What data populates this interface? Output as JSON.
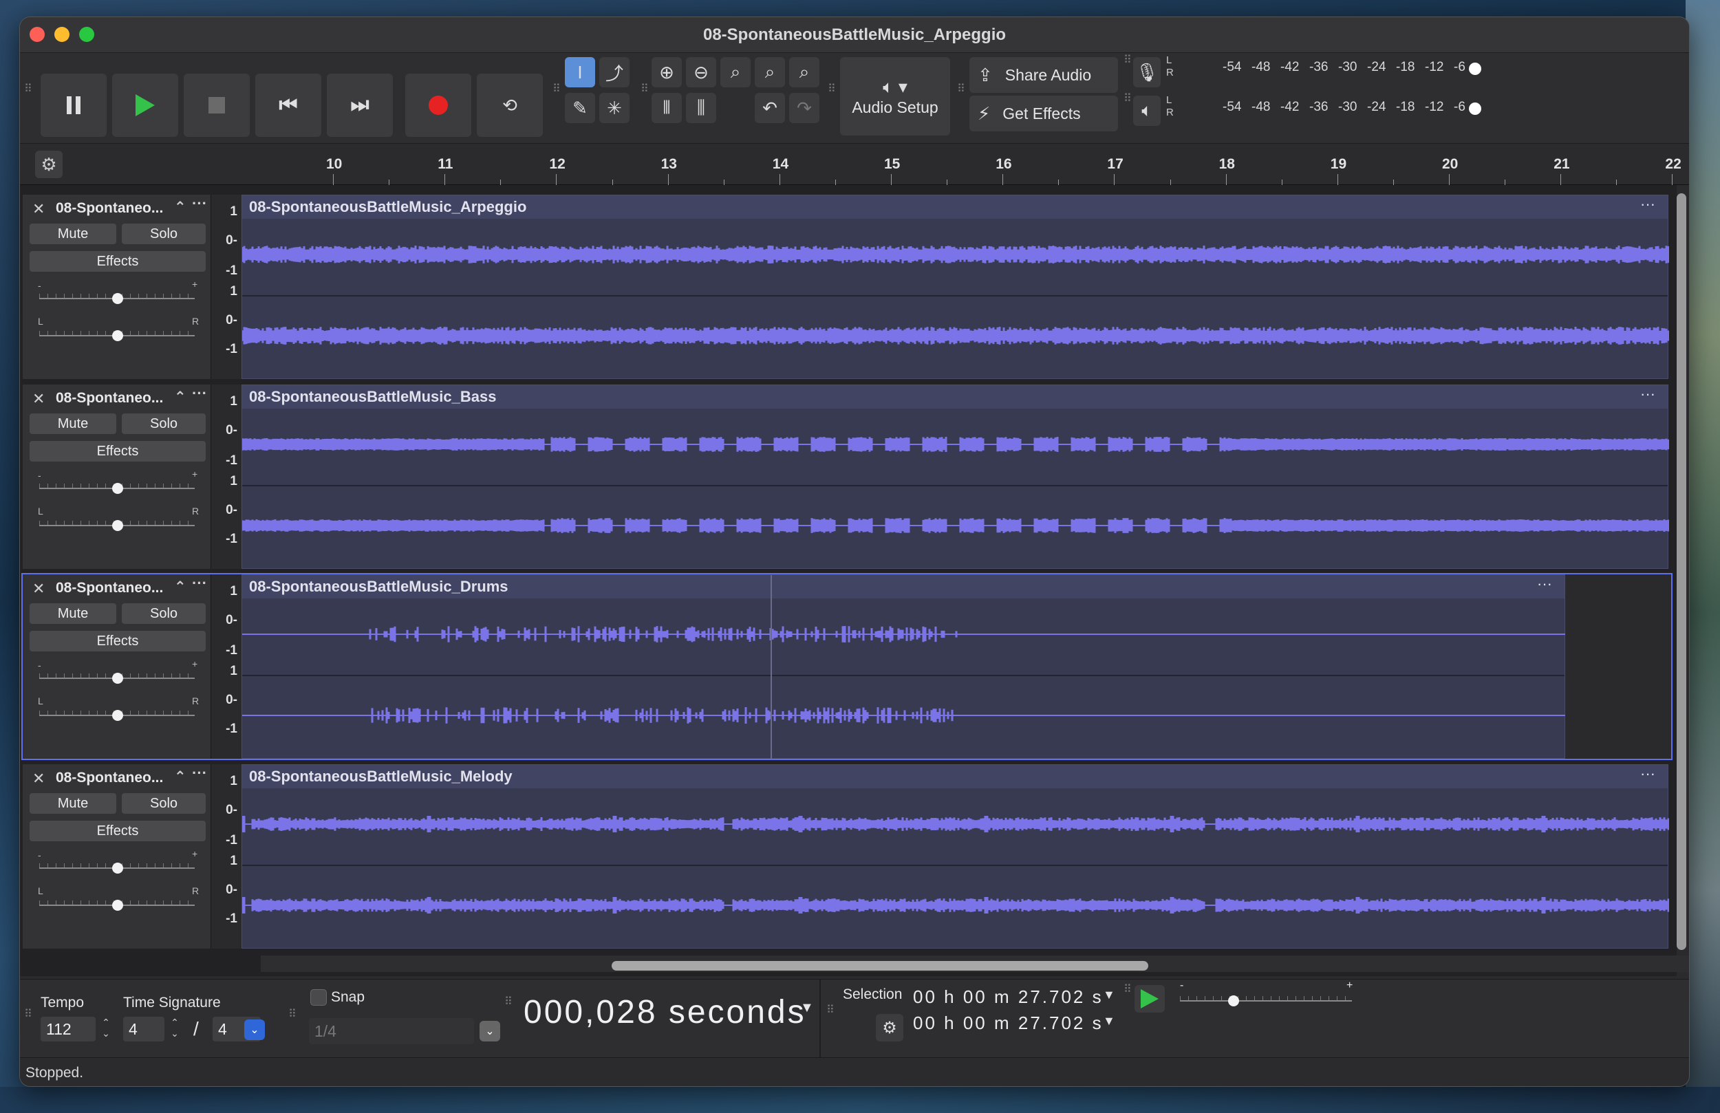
{
  "window": {
    "title": "08-SpontaneousBattleMusic_Arpeggio"
  },
  "toolbar": {
    "audio_setup_label": "Audio Setup",
    "share_audio_label": "Share Audio",
    "get_effects_label": "Get Effects",
    "meter_scale": [
      "-54",
      "-48",
      "-42",
      "-36",
      "-30",
      "-24",
      "-18",
      "-12",
      "-6"
    ],
    "meter_l": "L",
    "meter_r": "R"
  },
  "ruler": {
    "ticks": [
      "10",
      "11",
      "12",
      "13",
      "14",
      "15",
      "16",
      "17",
      "18",
      "19",
      "20",
      "21",
      "22"
    ]
  },
  "track_common": {
    "mute_label": "Mute",
    "solo_label": "Solo",
    "effects_label": "Effects",
    "gain_minus": "-",
    "gain_plus": "+",
    "pan_left": "L",
    "pan_right": "R",
    "scale_top": "1",
    "scale_mid": "0-",
    "scale_bot": "-1"
  },
  "tracks": [
    {
      "short_name": "08-Spontaneo...",
      "clip_name": "08-SpontaneousBattleMusic_Arpeggio",
      "selected": false
    },
    {
      "short_name": "08-Spontaneo...",
      "clip_name": "08-SpontaneousBattleMusic_Bass",
      "selected": false
    },
    {
      "short_name": "08-Spontaneo...",
      "clip_name": "08-SpontaneousBattleMusic_Drums",
      "selected": true
    },
    {
      "short_name": "08-Spontaneo...",
      "clip_name": "08-SpontaneousBattleMusic_Melody",
      "selected": false
    }
  ],
  "bottom": {
    "tempo_label": "Tempo",
    "tempo_value": "112",
    "time_sig_label": "Time Signature",
    "time_sig_top": "4",
    "time_sig_slash": "/",
    "time_sig_bottom": "4",
    "snap_label": "Snap",
    "snap_value": "1/4",
    "timer_value": "000,028 seconds",
    "selection_label": "Selection",
    "selection_start": "00 h 00 m 27.702 s",
    "selection_end": "00 h 00 m 27.702 s",
    "playback_minus": "-",
    "playback_plus": "+"
  },
  "status": {
    "text": "Stopped."
  },
  "colors": {
    "waveform": "#7b74e8",
    "selection_outline": "#5f6ff1",
    "play_green": "#35c24a",
    "record_red": "#e62222"
  }
}
